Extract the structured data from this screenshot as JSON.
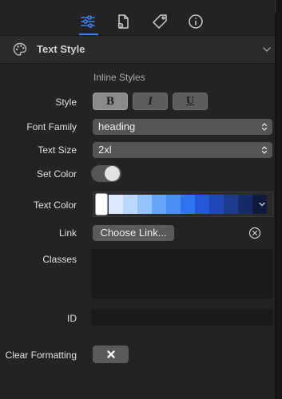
{
  "tabs": [
    {
      "name": "settings-sliders-icon",
      "active": true
    },
    {
      "name": "document-gear-icon",
      "active": false
    },
    {
      "name": "tag-icon",
      "active": false
    },
    {
      "name": "info-icon",
      "active": false
    }
  ],
  "section": {
    "title": "Text Style"
  },
  "inline_styles": {
    "heading": "Inline Styles",
    "style_label": "Style",
    "buttons": [
      {
        "label": "B",
        "active": true
      },
      {
        "label": "I",
        "active": false
      },
      {
        "label": "U",
        "active": false
      }
    ]
  },
  "font_family": {
    "label": "Font Family",
    "value": "heading"
  },
  "text_size": {
    "label": "Text Size",
    "value": "2xl"
  },
  "set_color": {
    "label": "Set Color",
    "on": true
  },
  "text_color": {
    "label": "Text Color",
    "selected": "#ffffff",
    "swatches": [
      "#dcebff",
      "#bcd8fd",
      "#92c3fb",
      "#65a6f7",
      "#4a90f5",
      "#3174ef",
      "#2458d9",
      "#1f47b8",
      "#1c3b8e",
      "#162a66",
      "#0f1a3d"
    ]
  },
  "link": {
    "label": "Link",
    "button": "Choose Link..."
  },
  "classes": {
    "label": "Classes",
    "value": ""
  },
  "id_field": {
    "label": "ID",
    "value": ""
  },
  "clear_formatting": {
    "label": "Clear Formatting"
  },
  "colors": {
    "accent": "#3e83f6",
    "panel": "#232323",
    "header": "#2b2b2b"
  }
}
